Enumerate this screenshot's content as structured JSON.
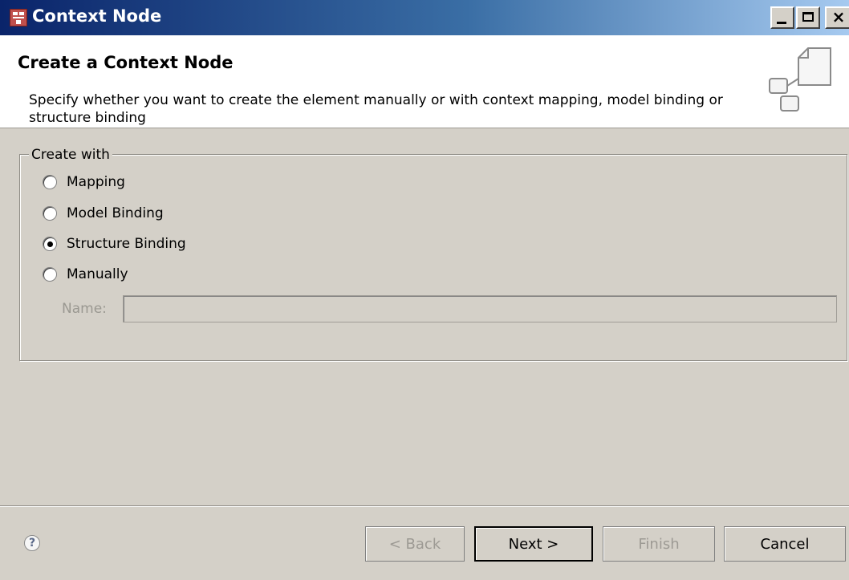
{
  "window": {
    "title": "Context Node",
    "controls": {
      "minimize": "_",
      "close": "×"
    }
  },
  "header": {
    "title": "Create a Context Node",
    "description": "Specify whether you want to create the element manually or with context mapping, model binding or structure binding",
    "icon": "wizard-banner-icon"
  },
  "create_with": {
    "legend": "Create with",
    "options": [
      {
        "label": "Mapping",
        "checked": false
      },
      {
        "label": "Model Binding",
        "checked": false
      },
      {
        "label": "Structure Binding",
        "checked": true
      },
      {
        "label": "Manually",
        "checked": false
      }
    ],
    "name_label": "Name:",
    "name_value": ""
  },
  "footer": {
    "help_icon": "?",
    "back_label": "< Back",
    "next_label": "Next >",
    "finish_label": "Finish",
    "cancel_label": "Cancel"
  }
}
